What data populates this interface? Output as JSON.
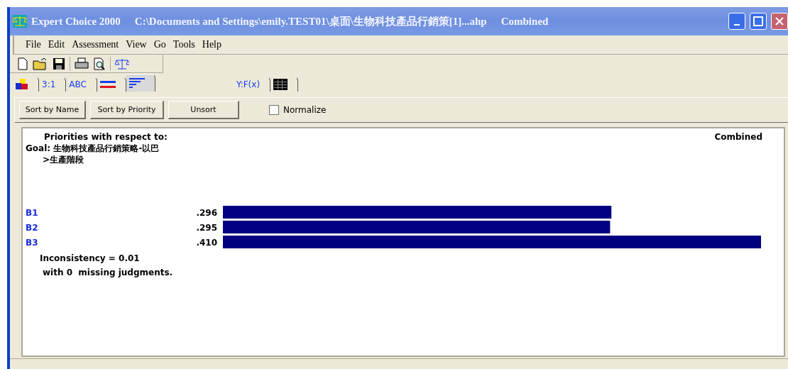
{
  "window": {
    "title": "Expert Choice 2000",
    "path": "C:\\Documents and Settings\\emily.TEST01\\桌面\\生物科技產品行銷策[1]...ahp",
    "mode": "Combined"
  },
  "menu": [
    "File",
    "Edit",
    "Assessment",
    "View",
    "Go",
    "Tools",
    "Help"
  ],
  "toolbar": [
    {
      "kind": "new"
    },
    {
      "kind": "open"
    },
    {
      "kind": "save"
    },
    {
      "kind": "sep"
    },
    {
      "kind": "print"
    },
    {
      "kind": "preview"
    },
    {
      "kind": "sep"
    },
    {
      "kind": "scale"
    }
  ],
  "tabs": [
    {
      "kind": "blocks",
      "selected": false
    },
    {
      "kind": "text",
      "label": "3:1",
      "selected": false
    },
    {
      "kind": "text",
      "label": "ABC",
      "selected": false
    },
    {
      "kind": "lines",
      "selected": false
    },
    {
      "kind": "sort",
      "selected": true
    }
  ],
  "tabs_right": [
    {
      "kind": "text",
      "label": "Y:F(x)",
      "selected": false
    },
    {
      "kind": "grid",
      "selected": false
    }
  ],
  "buttons": [
    "Sort by Name",
    "Sort by Priority",
    "Unsort"
  ],
  "normalize": {
    "label": "Normalize",
    "checked": false
  },
  "report": {
    "heading": "Priorities with respect to:",
    "mode": "Combined",
    "goal": "Goal: 生物科技產品行銷策略-以巴",
    "goal_line2": ">生產階段",
    "chart_data": {
      "type": "bar",
      "orientation": "horizontal",
      "categories": [
        "B1",
        "B2",
        "B3"
      ],
      "values": [
        0.296,
        0.295,
        0.41
      ],
      "value_labels": [
        ".296",
        ".295",
        ".410"
      ]
    },
    "inconsistency": "Inconsistency = 0.01",
    "missing": "with 0  missing judgments."
  }
}
